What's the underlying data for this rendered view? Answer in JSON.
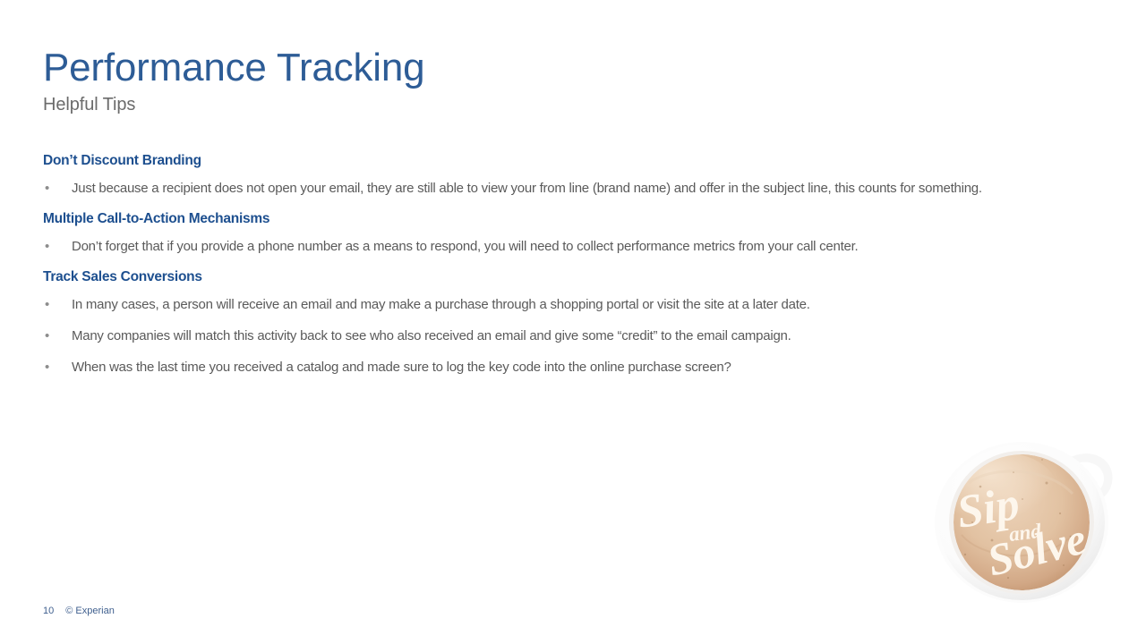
{
  "slide": {
    "title": "Performance Tracking",
    "subtitle": "Helpful Tips",
    "title_color": "#2d5c96",
    "heading_color": "#1d4f8f",
    "body_color": "#5a5a5a",
    "background_color": "#ffffff"
  },
  "sections": [
    {
      "heading": "Don’t Discount Branding",
      "bullets": [
        "Just because a recipient does not open your email, they are still able to view your from line (brand name) and offer in the subject line, this counts for something."
      ]
    },
    {
      "heading": "Multiple Call-to-Action Mechanisms",
      "bullets": [
        "Don’t forget that if you provide a phone number as a means to respond, you will need to collect performance metrics from your call center."
      ]
    },
    {
      "heading": "Track Sales Conversions",
      "bullets": [
        "In many cases, a person will receive an email and may make a purchase through a shopping portal or visit the site at a later date.",
        "Many companies will match this activity back to see who also received an email and give some “credit” to the email campaign.",
        "When was the last time you received a catalog and made sure to log the key code into the online purchase screen?"
      ]
    }
  ],
  "bullet_glyph": "•",
  "footer": {
    "page_number": "10",
    "copyright": "© Experian"
  },
  "logo": {
    "name": "sip-and-solve-coffee-cup",
    "text_line1": "Sip",
    "text_small": "and",
    "text_line2": "Solve",
    "coffee_color": "#e3c3a4",
    "coffee_color_dark": "#cfa685",
    "foam_color": "#fbf4ec",
    "cup_color": "#ffffff",
    "cup_shadow": "#ececec"
  }
}
